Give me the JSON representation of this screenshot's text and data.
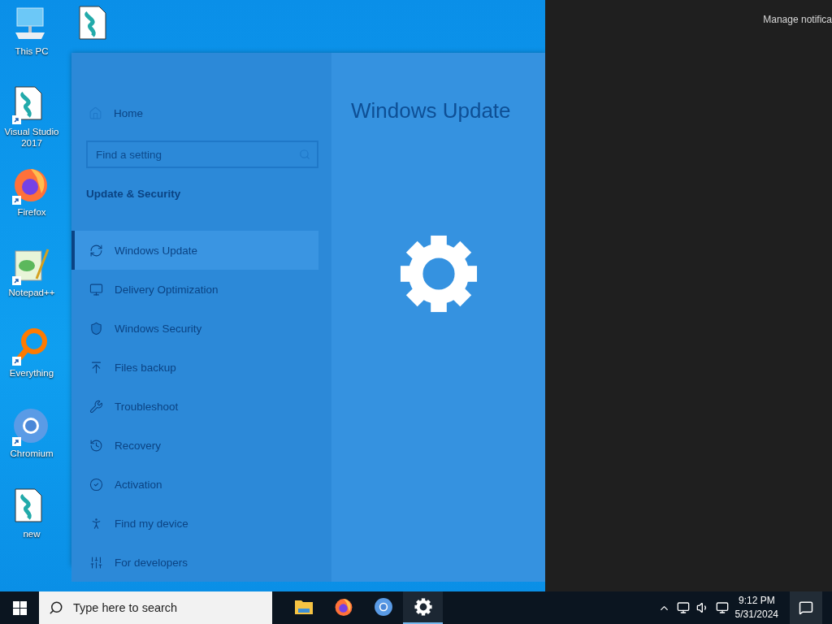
{
  "desktop_icons": [
    {
      "kind": "pc",
      "label": "This PC",
      "shortcut": false
    },
    {
      "kind": "script",
      "label": "Visual Studio 2017",
      "shortcut": true
    },
    {
      "kind": "firefox",
      "label": "Firefox",
      "shortcut": true
    },
    {
      "kind": "notepad",
      "label": "Notepad++",
      "shortcut": true
    },
    {
      "kind": "everything",
      "label": "Everything",
      "shortcut": true
    },
    {
      "kind": "chromium",
      "label": "Chromium",
      "shortcut": true
    },
    {
      "kind": "script",
      "label": "new",
      "shortcut": false
    }
  ],
  "desktop_icon_top": {
    "kind": "script",
    "shortcut": false
  },
  "settings_window": {
    "title": "Windows Update",
    "home": "Home",
    "search": {
      "placeholder": "Find a setting"
    },
    "section": "Update & Security",
    "items": [
      {
        "kind": "update",
        "label": "Windows Update",
        "selected": true
      },
      {
        "kind": "delivery",
        "label": "Delivery Optimization",
        "selected": false
      },
      {
        "kind": "shield",
        "label": "Windows Security",
        "selected": false
      },
      {
        "kind": "backup",
        "label": "Files backup",
        "selected": false
      },
      {
        "kind": "wrench",
        "label": "Troubleshoot",
        "selected": false
      },
      {
        "kind": "recovery",
        "label": "Recovery",
        "selected": false
      },
      {
        "kind": "activation",
        "label": "Activation",
        "selected": false
      },
      {
        "kind": "find",
        "label": "Find my device",
        "selected": false
      },
      {
        "kind": "developers",
        "label": "For developers",
        "selected": false
      }
    ]
  },
  "action_center": {
    "link": "Manage notifica"
  },
  "taskbar": {
    "search": {
      "placeholder": "Type here to search"
    },
    "apps": [
      {
        "kind": "explorer",
        "active": false
      },
      {
        "kind": "firefox",
        "active": false
      },
      {
        "kind": "chromium",
        "active": false
      },
      {
        "kind": "settings",
        "active": true
      }
    ],
    "time": "9:12 PM",
    "date": "5/31/2024"
  }
}
